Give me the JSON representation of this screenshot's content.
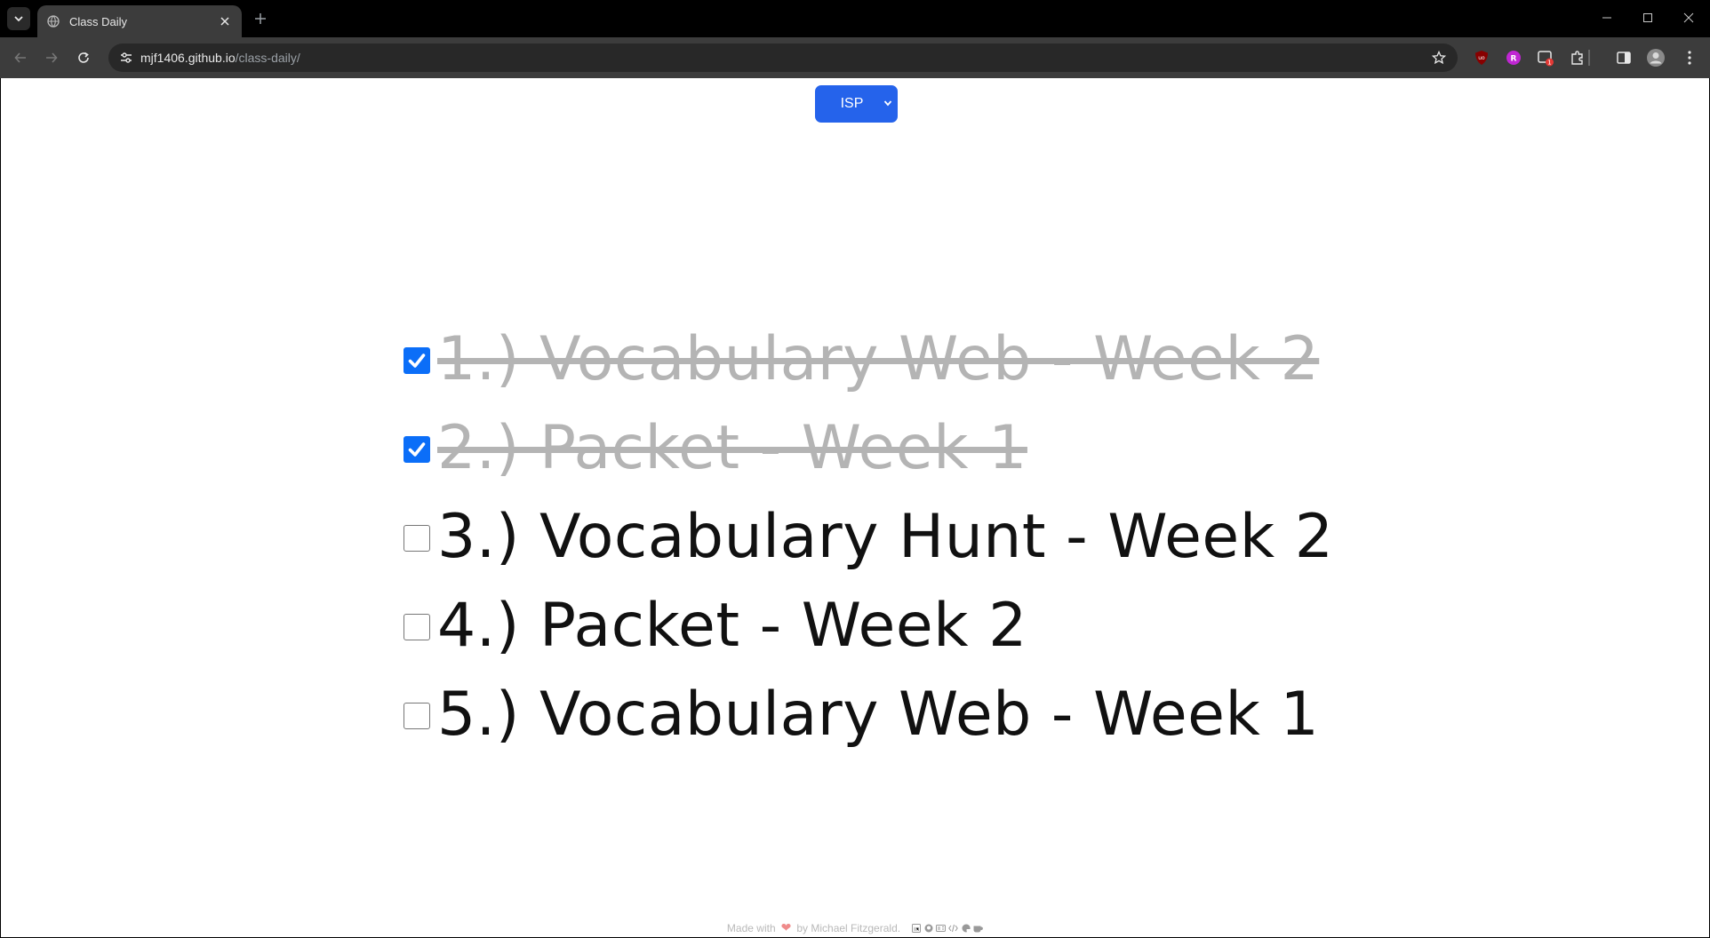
{
  "browser": {
    "tab_title": "Class Daily",
    "url_host": "mjf1406.github.io",
    "url_path": "/class-daily/",
    "extension_badge": "1"
  },
  "page": {
    "subject_select": {
      "value": "ISP"
    },
    "tasks": [
      {
        "label": "1.) Vocabulary Web - Week 2",
        "completed": true
      },
      {
        "label": "2.) Packet - Week 1",
        "completed": true
      },
      {
        "label": "3.) Vocabulary Hunt - Week 2",
        "completed": false
      },
      {
        "label": "4.) Packet - Week 2",
        "completed": false
      },
      {
        "label": "5.) Vocabulary Web - Week 1",
        "completed": false
      }
    ],
    "footer": {
      "made_with": "Made with",
      "by": "by Michael Fitzgerald.",
      "icons": [
        "linkedin-icon",
        "github-icon",
        "id-card-icon",
        "code-icon",
        "palette-icon",
        "coffee-icon"
      ]
    }
  },
  "colors": {
    "select_bg": "#2563eb",
    "checkbox_checked": "#0b6ef8",
    "done_text": "#b4b4b4"
  }
}
